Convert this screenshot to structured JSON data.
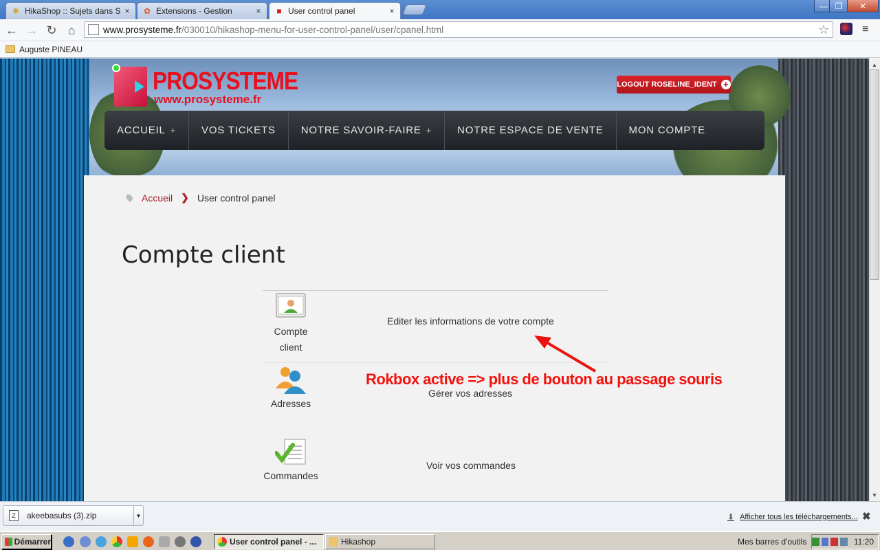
{
  "browser": {
    "tabs": [
      {
        "title": "HikaShop :: Sujets dans Sup",
        "icon": "hikashop-icon",
        "active": false
      },
      {
        "title": "Extensions - Gestion",
        "icon": "joomla-icon",
        "active": false
      },
      {
        "title": "User control panel",
        "icon": "joomla-icon",
        "active": true
      }
    ],
    "tab_close": "×",
    "url_domain": "www.prosysteme.fr",
    "url_path": "/030010/hikashop-menu-for-user-control-panel/user/cpanel.html",
    "bookmark": "Auguste PINEAU",
    "window_controls": {
      "minimize": "—",
      "maximize": "❐",
      "close": "✕"
    },
    "nav": {
      "back": "←",
      "forward": "→",
      "reload": "↻",
      "home": "⌂",
      "star": "☆",
      "menu": "≡"
    }
  },
  "site": {
    "logo_title": "PROSYSTEME",
    "logo_url": "www.prosysteme.fr",
    "logout_label": "LOGOUT ROSELINE_IDENT",
    "logout_plus": "+",
    "menu": [
      {
        "label": "ACCUEIL",
        "has_sub": true
      },
      {
        "label": "VOS TICKETS",
        "has_sub": false
      },
      {
        "label": "NOTRE SAVOIR-FAIRE",
        "has_sub": true
      },
      {
        "label": "NOTRE ESPACE DE VENTE",
        "has_sub": false
      },
      {
        "label": "MON COMPTE",
        "has_sub": false
      }
    ],
    "menu_plus": "+"
  },
  "breadcrumb": {
    "home": "Accueil",
    "separator": "❯",
    "current": "User control panel"
  },
  "page_title": "Compte client",
  "cpanel": [
    {
      "label_line1": "Compte",
      "label_line2": "client",
      "icon": "user-card-icon",
      "description": "Editer les informations de votre compte"
    },
    {
      "label_line1": "Adresses",
      "label_line2": "",
      "icon": "users-icon",
      "description": "Gérer vos adresses"
    },
    {
      "label_line1": "Commandes",
      "label_line2": "",
      "icon": "orders-check-icon",
      "description": "Voir vos commandes"
    }
  ],
  "annotation": "Rokbox active => plus de bouton au passage souris",
  "downloads": {
    "item": "akeebasubs (3).zip",
    "show_all": "Afficher tous les téléchargements...",
    "close": "✖"
  },
  "taskbar": {
    "start": "Démarrer",
    "buttons": [
      {
        "label": "User control panel - ...",
        "active": true
      },
      {
        "label": "Hikashop",
        "active": false
      }
    ],
    "toolbars": "Mes barres d'outils",
    "chevron": "»",
    "clock": "11:20"
  }
}
